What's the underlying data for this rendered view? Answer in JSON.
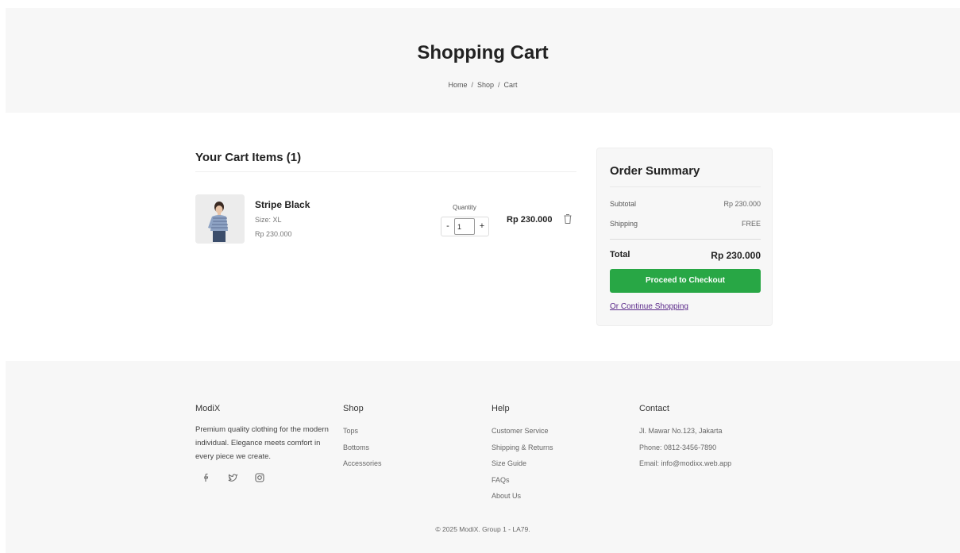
{
  "header": {
    "title": "Shopping Cart",
    "breadcrumb": [
      "Home",
      "Shop",
      "Cart"
    ]
  },
  "cart": {
    "heading": "Your Cart Items (1)",
    "items": [
      {
        "name": "Stripe Black",
        "size": "Size: XL",
        "unit_price": "Rp 230.000",
        "quantity_label": "Quantity",
        "quantity": "1",
        "decrement": "-",
        "increment": "+",
        "total": "Rp 230.000"
      }
    ]
  },
  "summary": {
    "title": "Order Summary",
    "subtotal_label": "Subtotal",
    "subtotal_value": "Rp 230.000",
    "shipping_label": "Shipping",
    "shipping_value": "FREE",
    "total_label": "Total",
    "total_value": "Rp 230.000",
    "checkout_label": "Proceed to Checkout",
    "continue_label": "Or Continue Shopping"
  },
  "footer": {
    "brand": {
      "title": "ModiX",
      "description": "Premium quality clothing for the modern individual. Elegance meets comfort in every piece we create.",
      "social_icons": [
        "facebook-icon",
        "twitter-icon",
        "instagram-icon"
      ]
    },
    "shop": {
      "title": "Shop",
      "links": [
        "Tops",
        "Bottoms",
        "Accessories"
      ]
    },
    "help": {
      "title": "Help",
      "links": [
        "Customer Service",
        "Shipping & Returns",
        "Size Guide",
        "FAQs",
        "About Us"
      ]
    },
    "contact": {
      "title": "Contact",
      "lines": [
        "Jl. Mawar No.123, Jakarta",
        "Phone: 0812-3456-7890",
        "Email: info@modixx.web.app"
      ]
    },
    "copyright": "© 2025 ModiX. Group 1 - LA79."
  },
  "colors": {
    "accent_green": "#28a745",
    "link_purple": "#5b2a8a",
    "panel_bg": "#f7f7f7"
  }
}
